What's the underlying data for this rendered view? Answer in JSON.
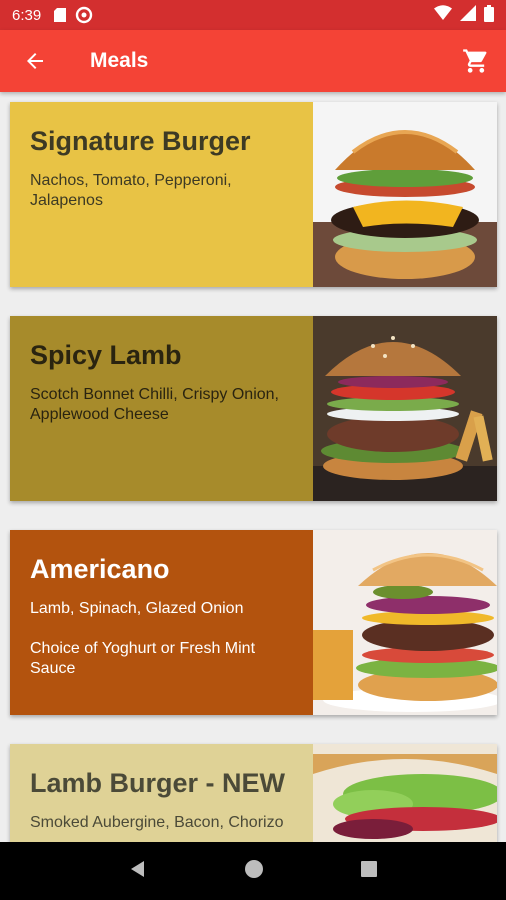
{
  "status": {
    "time": "6:39"
  },
  "appbar": {
    "title": "Meals",
    "back_icon": "arrow-left-icon",
    "cart_icon": "shopping-cart-icon"
  },
  "colors": {
    "status_bar": "#d32f2f",
    "app_bar": "#f44336",
    "card1": "#e8c345",
    "card2": "#a78b2b",
    "card3": "#b3530e",
    "card4": "#dfd296"
  },
  "meals": [
    {
      "name": "Signature Burger",
      "desc": "Nachos, Tomato, Pepperoni, Jalapenos",
      "desc2": ""
    },
    {
      "name": "Spicy Lamb",
      "desc": "Scotch Bonnet Chilli, Crispy Onion, Applewood Cheese",
      "desc2": ""
    },
    {
      "name": "Americano",
      "desc": "Lamb, Spinach, Glazed Onion",
      "desc2": "Choice of Yoghurt or Fresh Mint Sauce"
    },
    {
      "name": "Lamb Burger - NEW",
      "desc": "Smoked Aubergine, Bacon, Chorizo",
      "desc2": ""
    }
  ]
}
